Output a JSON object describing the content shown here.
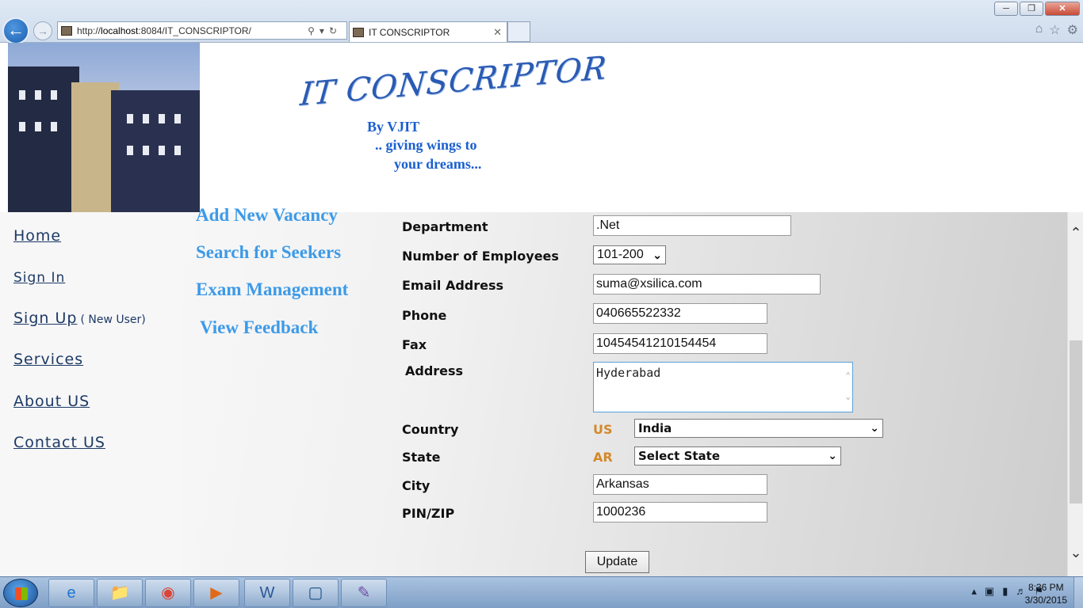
{
  "browser": {
    "url_prefix": "http://",
    "url_host": "localhost",
    "url_rest": ":8084/IT_CONSCRIPTOR/",
    "tab_title": "IT CONSCRIPTOR",
    "window_controls": [
      "minimize",
      "restore",
      "close"
    ],
    "right_icons": [
      "home-icon",
      "star-icon",
      "gear-icon"
    ]
  },
  "header": {
    "logo_text": "IT CONSCRIPTOR",
    "by_line": "By VJIT",
    "tagline_1": ".. giving wings to",
    "tagline_2": "your dreams..."
  },
  "left_nav": {
    "home": "Home",
    "sign_in": "Sign In",
    "sign_up": "Sign Up",
    "sign_up_note": "( New User)",
    "services": "Services",
    "about": "About US",
    "contact": "Contact US"
  },
  "menu": {
    "add_vacancy": "Add New Vacancy",
    "search_seekers": "Search for Seekers",
    "exam_management": "Exam Management",
    "view_feedback": "View Feedback"
  },
  "form": {
    "department_label": "Department",
    "department_value": ".Net",
    "employees_label": "Number of Employees",
    "employees_value": "101-200",
    "email_label": "Email Address",
    "email_value": "suma@xsilica.com",
    "phone_label": "Phone",
    "phone_value": "040665522332",
    "fax_label": "Fax",
    "fax_value": "10454541210154454",
    "address_label": "Address",
    "address_value": "Hyderabad",
    "country_label": "Country",
    "country_code": "US",
    "country_value": "India",
    "state_label": "State",
    "state_code": "AR",
    "state_value": "Select State",
    "city_label": "City",
    "city_value": "Arkansas",
    "pin_label": "PIN/ZIP",
    "pin_value": "1000236",
    "update_label": "Update"
  },
  "taskbar": {
    "items": [
      "ie-icon",
      "explorer-icon",
      "chrome-icon",
      "media-player-icon",
      "word-icon",
      "virtualbox-icon",
      "paint-icon"
    ],
    "time": "8:36 PM",
    "date": "3/30/2015"
  },
  "colors": {
    "nav_text": "#1d3a66",
    "menu_text": "#3d9ae8",
    "code_text": "#d4892b",
    "tagline": "#1a5fd0"
  }
}
